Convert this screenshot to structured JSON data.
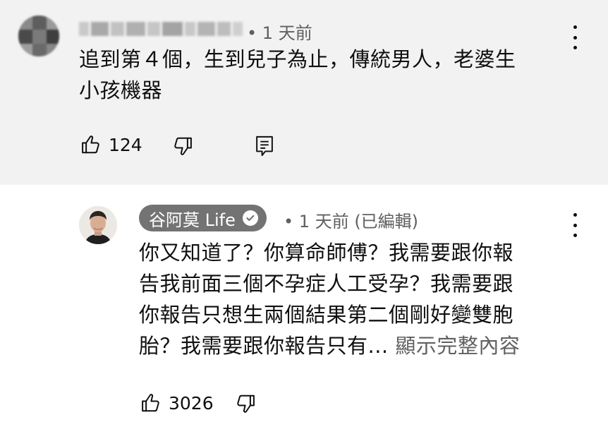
{
  "comment": {
    "timestamp": "1 天前",
    "text_line1": "追到第４個，生到兒子為止，傳統男人，老婆生",
    "text_line2": "小孩機器",
    "like_count": "124"
  },
  "reply": {
    "channel_name": "谷阿莫 Life",
    "timestamp": "1 天前 (已編輯)",
    "text_line1": "你又知道了？你算命師傅？我需要跟你報",
    "text_line2": "告我前面三個不孕症人工受孕？我需要跟",
    "text_line3": "你報告只想生兩個結果第二個剛好變雙胞",
    "text_line4": "胎？我需要跟你報告只有...",
    "show_more": "顯示完整內容",
    "like_count": "3026"
  },
  "icons": {
    "like": "thumbs-up-icon",
    "dislike": "thumbs-down-icon",
    "reply": "reply-icon",
    "more": "more-vert-icon",
    "verified": "check-circle-icon"
  },
  "colors": {
    "top_background": "#f2f2f2",
    "chip_background": "#737373",
    "secondary_text": "#606060"
  }
}
